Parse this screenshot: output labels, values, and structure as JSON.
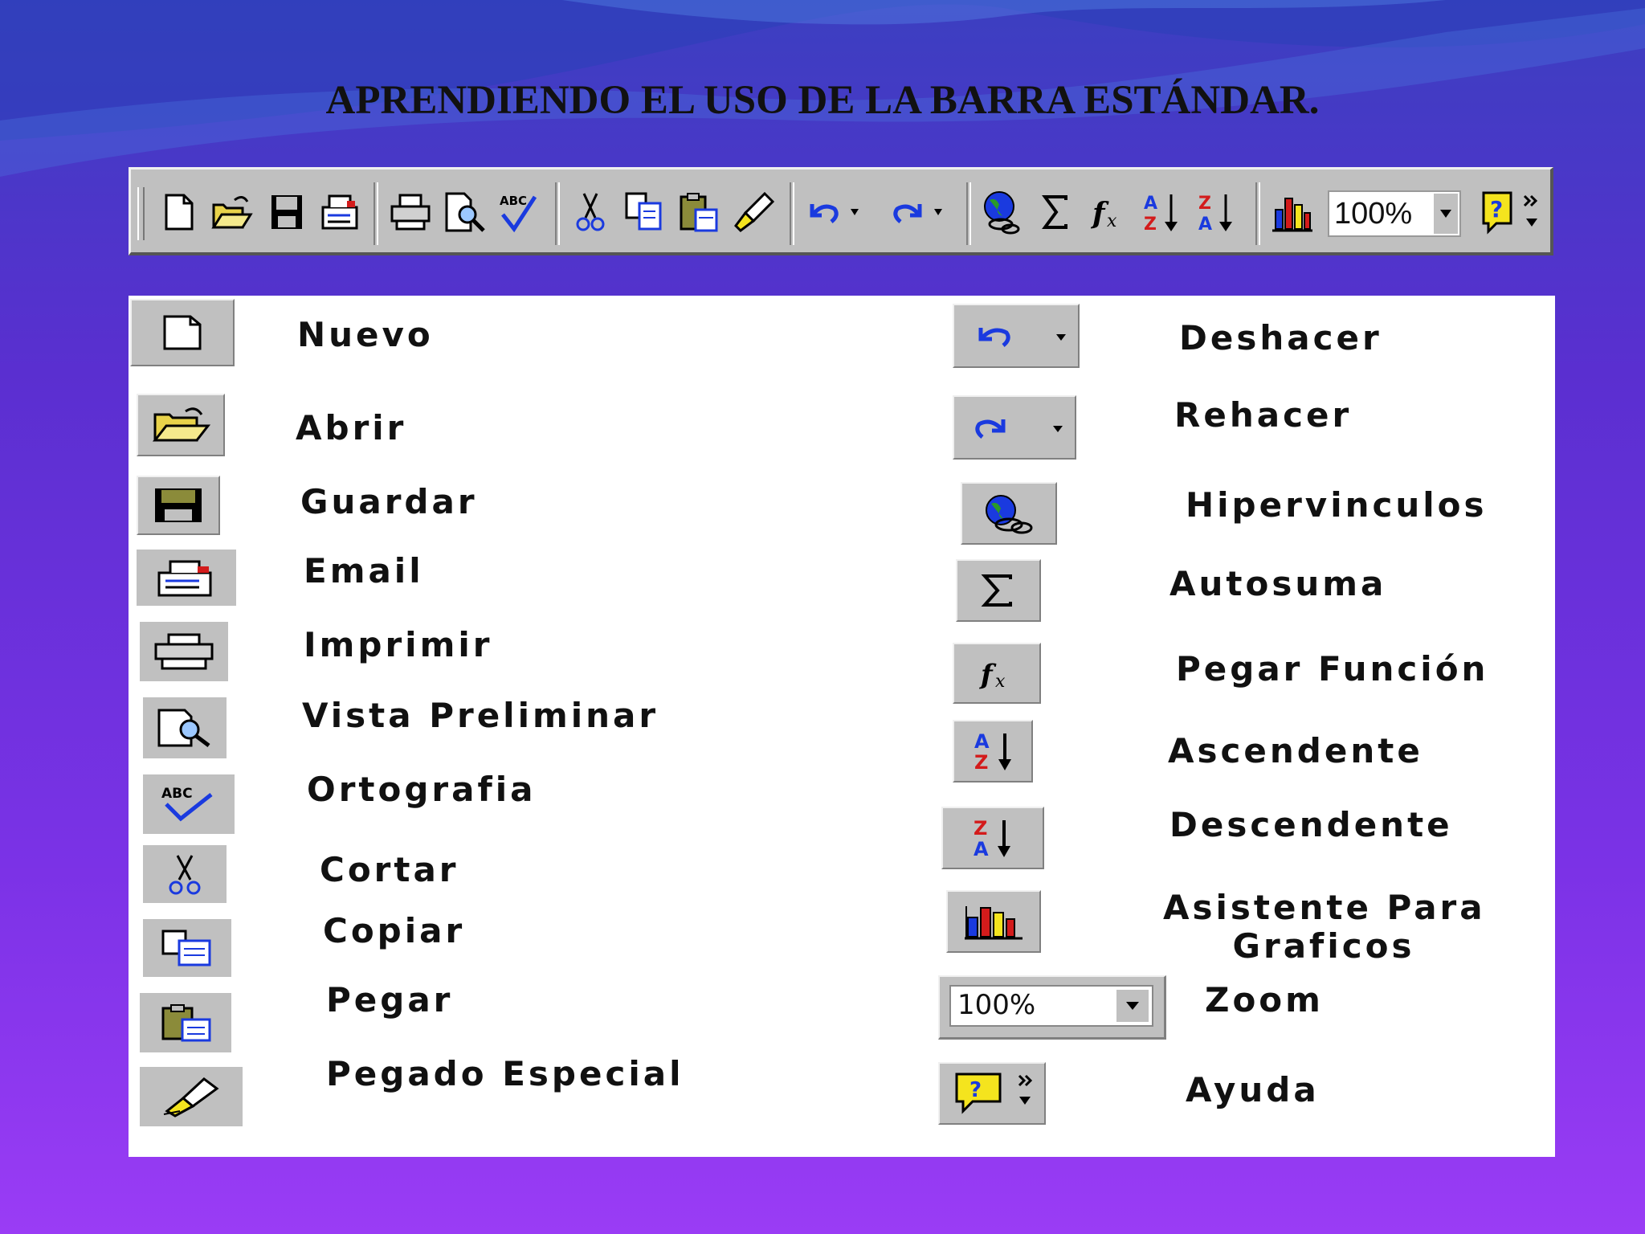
{
  "slide": {
    "title": "APRENDIENDO EL USO DE LA BARRA ESTÁNDAR."
  },
  "toolbar": {
    "zoom_value": "100%",
    "buttons": [
      "new",
      "open",
      "save",
      "email",
      "print",
      "print-preview",
      "spelling",
      "cut",
      "copy",
      "paste",
      "format-painter",
      "undo",
      "redo",
      "hyperlink",
      "autosum",
      "paste-function",
      "sort-ascending",
      "sort-descending",
      "chart-wizard",
      "zoom",
      "help"
    ]
  },
  "legend": {
    "left": [
      {
        "label": "Nuevo",
        "icon": "new-document-icon"
      },
      {
        "label": "Abrir",
        "icon": "open-folder-icon"
      },
      {
        "label": "Guardar",
        "icon": "save-disk-icon"
      },
      {
        "label": "Email",
        "icon": "email-icon"
      },
      {
        "label": "Imprimir",
        "icon": "printer-icon"
      },
      {
        "label": "Vista Preliminar",
        "icon": "print-preview-icon"
      },
      {
        "label": "Ortografia",
        "icon": "spelling-icon"
      },
      {
        "label": "Cortar",
        "icon": "scissors-icon"
      },
      {
        "label": "Copiar",
        "icon": "copy-icon"
      },
      {
        "label": "Pegar",
        "icon": "paste-icon"
      },
      {
        "label": "Pegado Especial",
        "icon": "brush-icon"
      }
    ],
    "right": [
      {
        "label": "Deshacer",
        "icon": "undo-icon"
      },
      {
        "label": "Rehacer",
        "icon": "redo-icon"
      },
      {
        "label": "Hipervinculos",
        "icon": "globe-link-icon"
      },
      {
        "label": "Autosuma",
        "icon": "sigma-icon"
      },
      {
        "label": "Pegar Función",
        "icon": "function-icon"
      },
      {
        "label": "Ascendente",
        "icon": "sort-ascending-icon"
      },
      {
        "label": "Descendente",
        "icon": "sort-descending-icon"
      },
      {
        "label_line1": "Asistente Para",
        "label_line2": "Graficos",
        "icon": "chart-icon"
      },
      {
        "label": "Zoom",
        "icon": "zoom-dropdown",
        "value": "100%"
      },
      {
        "label": "Ayuda",
        "icon": "help-icon"
      }
    ]
  },
  "colors": {
    "background_top": "#3b3fc0",
    "background_bottom": "#9a3cf5",
    "button_face": "#c0c0c0",
    "icon_blue": "#1a3adf",
    "icon_red": "#d31b1b",
    "icon_yellow": "#f4e41e"
  }
}
